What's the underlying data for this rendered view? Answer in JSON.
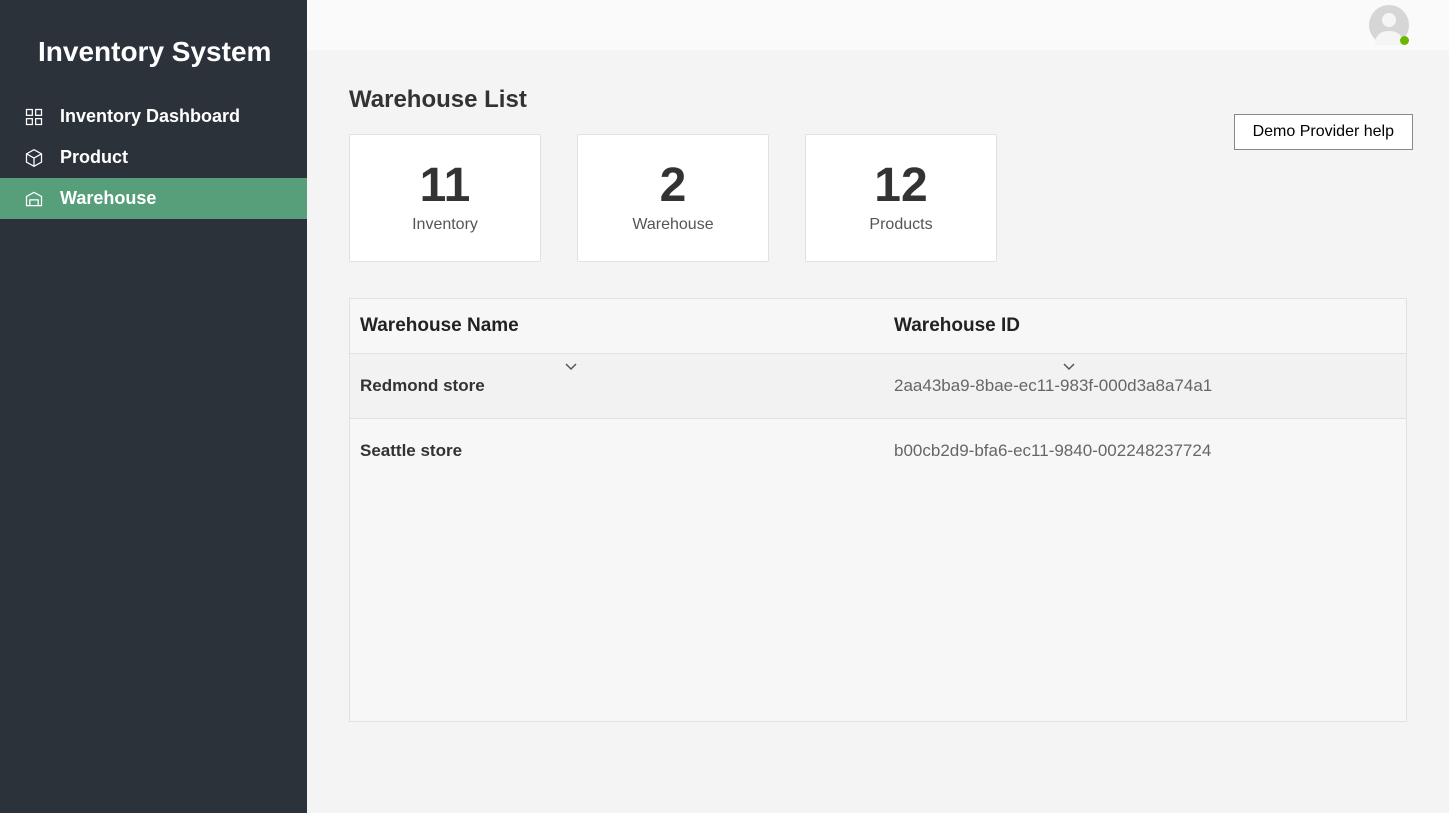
{
  "app": {
    "title": "Inventory System"
  },
  "sidebar": {
    "items": [
      {
        "label": "Inventory Dashboard"
      },
      {
        "label": "Product"
      },
      {
        "label": "Warehouse"
      }
    ]
  },
  "page": {
    "title": "Warehouse List",
    "help_button": "Demo Provider help"
  },
  "stats": [
    {
      "value": "11",
      "label": "Inventory"
    },
    {
      "value": "2",
      "label": "Warehouse"
    },
    {
      "value": "12",
      "label": "Products"
    }
  ],
  "table": {
    "columns": [
      {
        "label": "Warehouse Name"
      },
      {
        "label": "Warehouse ID"
      }
    ],
    "rows": [
      {
        "name": "Redmond store",
        "id": "2aa43ba9-8bae-ec11-983f-000d3a8a74a1"
      },
      {
        "name": "Seattle store",
        "id": "b00cb2d9-bfa6-ec11-9840-002248237724"
      }
    ]
  }
}
